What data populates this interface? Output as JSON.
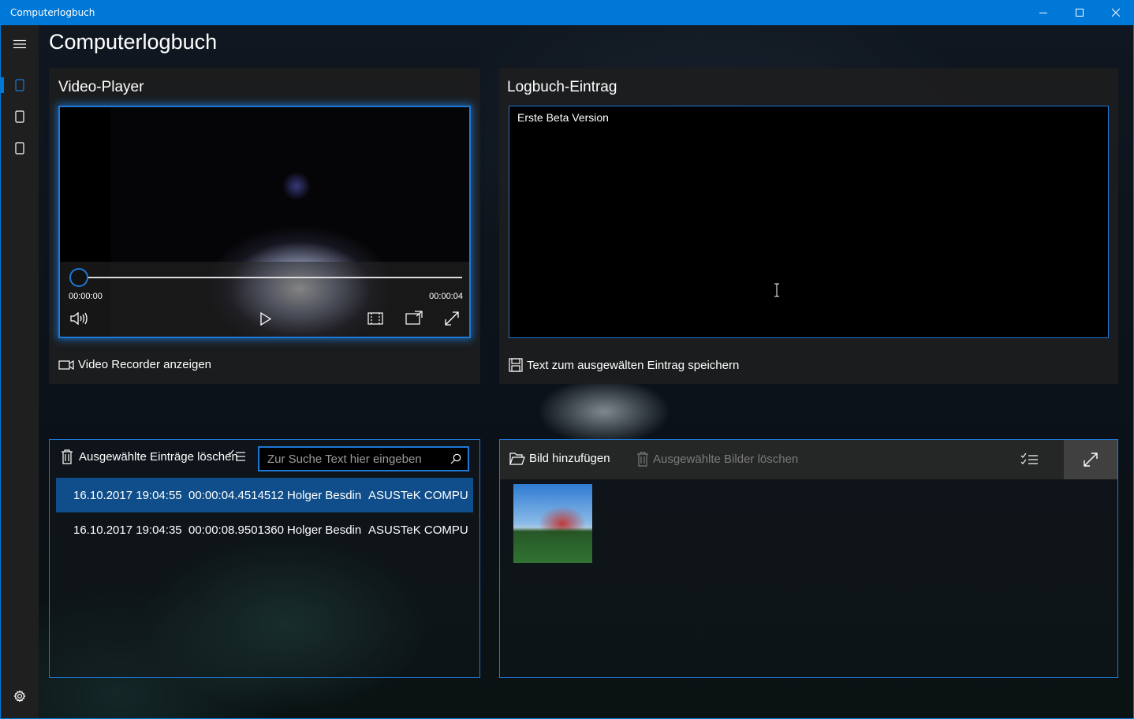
{
  "window": {
    "title": "Computerlogbuch"
  },
  "page": {
    "title": "Computerlogbuch"
  },
  "sidebar": {
    "items": [
      {
        "icon": "page-icon",
        "selected": true
      },
      {
        "icon": "page-icon",
        "selected": false
      },
      {
        "icon": "page-icon",
        "selected": false
      }
    ],
    "settings_icon": "gear-icon"
  },
  "video_panel": {
    "title": "Video-Player",
    "time_current": "00:00:00",
    "time_total": "00:00:04",
    "progress": 0,
    "recorder_label": "Video Recorder anzeigen"
  },
  "log_panel": {
    "title": "Logbuch-Eintrag",
    "text": "Erste Beta Version",
    "save_label": "Text zum ausgewälten Eintrag speichern"
  },
  "entries_panel": {
    "delete_label": "Ausgewählte Einträge löschen",
    "search_placeholder": "Zur Suche Text hier eingeben",
    "rows": [
      {
        "date": "16.10.2017 19:04:55",
        "duration": "00:00:04.4514512",
        "user": "Holger Besdin",
        "computer": "ASUSTeK COMPU",
        "selected": true
      },
      {
        "date": "16.10.2017 19:04:35",
        "duration": "00:00:08.9501360",
        "user": "Holger Besdin",
        "computer": "ASUSTeK COMPU",
        "selected": false
      }
    ]
  },
  "images_panel": {
    "add_label": "Bild hinzufügen",
    "delete_label": "Ausgewählte Bilder löschen"
  },
  "colors": {
    "accent": "#0078d7",
    "selection": "#0f4e8a",
    "panel": "#1e1e1e"
  }
}
